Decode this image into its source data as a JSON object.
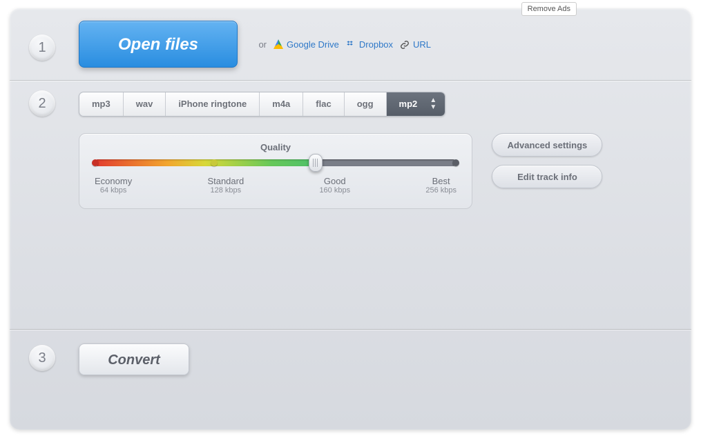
{
  "remove_ads": "Remove Ads",
  "steps": {
    "s1": "1",
    "s2": "2",
    "s3": "3"
  },
  "open": {
    "label": "Open files",
    "or": "or",
    "gdrive": "Google Drive",
    "dropbox": "Dropbox",
    "url": "URL"
  },
  "formats": {
    "mp3": "mp3",
    "wav": "wav",
    "iphone": "iPhone ringtone",
    "m4a": "m4a",
    "flac": "flac",
    "ogg": "ogg",
    "mp2": "mp2",
    "selected": "mp2"
  },
  "quality": {
    "title": "Quality",
    "stops": [
      {
        "name": "Economy",
        "rate": "64 kbps"
      },
      {
        "name": "Standard",
        "rate": "128 kbps"
      },
      {
        "name": "Good",
        "rate": "160 kbps"
      },
      {
        "name": "Best",
        "rate": "256 kbps"
      }
    ],
    "selected_index": 2
  },
  "side": {
    "advanced": "Advanced settings",
    "edit_track": "Edit track info"
  },
  "convert": {
    "label": "Convert"
  }
}
